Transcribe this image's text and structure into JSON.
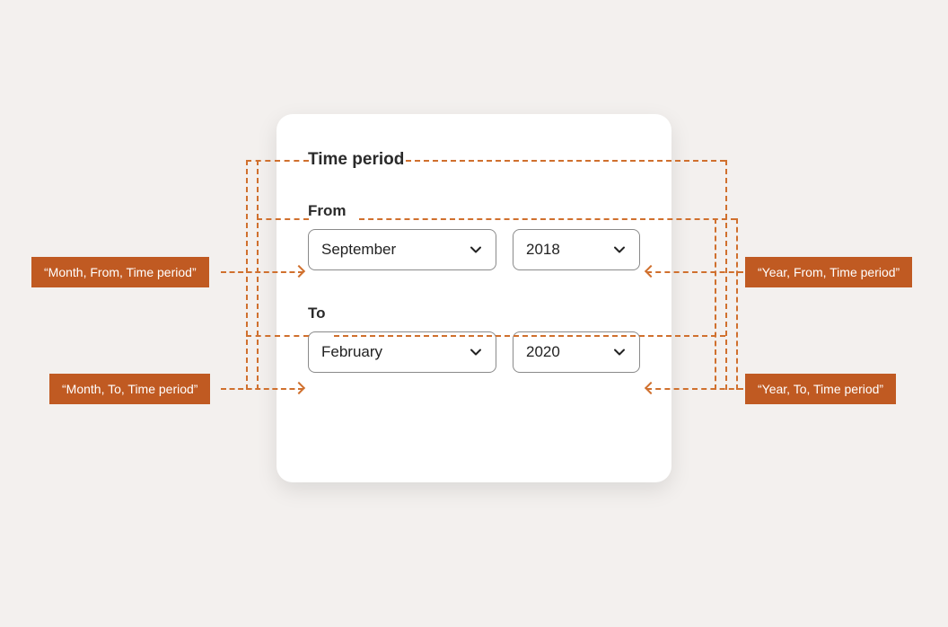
{
  "card": {
    "title": "Time period",
    "from": {
      "label": "From",
      "month": "September",
      "year": "2018"
    },
    "to": {
      "label": "To",
      "month": "February",
      "year": "2020"
    }
  },
  "annotations": {
    "month_from": "“Month, From, Time period”",
    "month_to": "“Month, To, Time period”",
    "year_from": "“Year, From, Time period”",
    "year_to": "“Year, To, Time period”"
  }
}
